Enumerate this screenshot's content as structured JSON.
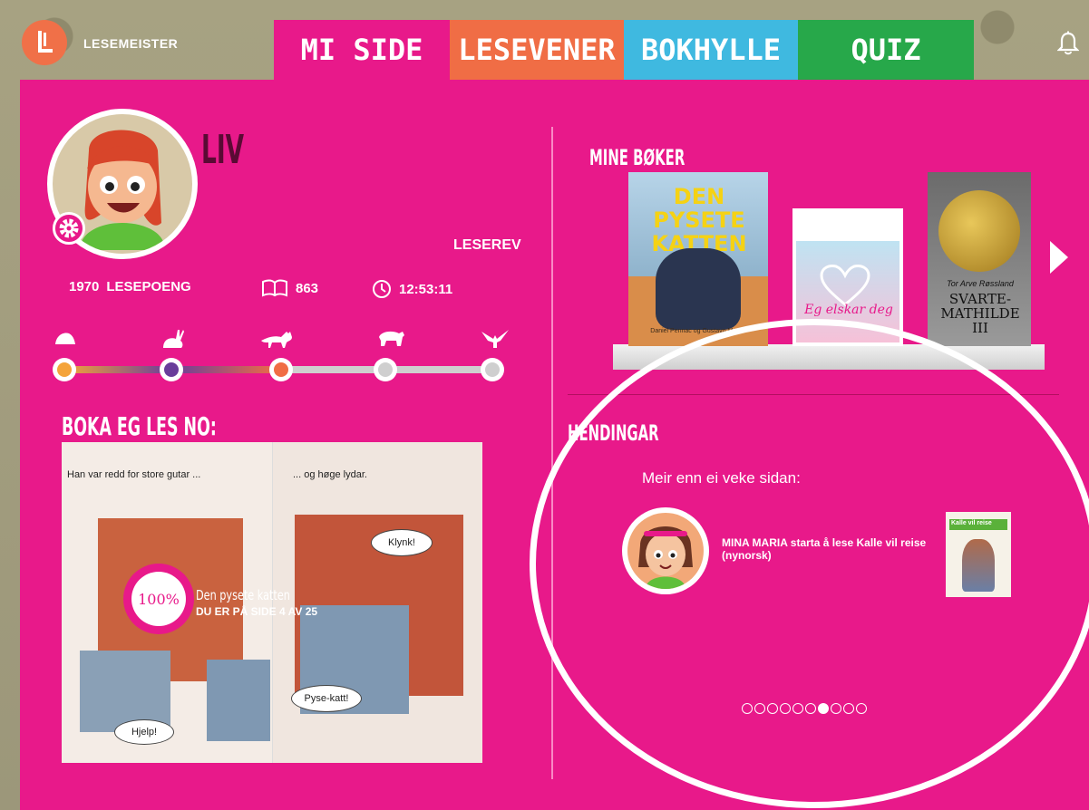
{
  "app": {
    "name": "LESEMEISTER"
  },
  "tabs": [
    {
      "label": "MI SIDE",
      "color": "#e8198a"
    },
    {
      "label": "LESEVENER",
      "color": "#f06d45"
    },
    {
      "label": "BOKHYLLE",
      "color": "#3fb9e0"
    },
    {
      "label": "QUIZ",
      "color": "#27a84a"
    }
  ],
  "profile": {
    "name": "LIV",
    "level": "LESEREV",
    "points": "1970",
    "points_label": "LESEPOENG",
    "pages": "863",
    "time": "12:53:11",
    "progress_fraction": 0.5
  },
  "reading": {
    "header": "BOKA EG LES NO:",
    "caption_left": "Han var redd for store gutar ...",
    "caption_right": "... og høge lydar.",
    "bubble1": "Klynk!",
    "bubble2": "Pyse-katt!",
    "bubble3": "Hjelp!",
    "percent": "100%",
    "title": "Den pysete katten",
    "page_status": "DU ER PÅ SIDE 4 AV 25"
  },
  "books": {
    "header": "MINE BØKER",
    "items": [
      {
        "title": "DEN PYSETE KATTEN",
        "authors": "Daniel Pennac og Gustavo Mazali"
      },
      {
        "title": "Eg elskar deg"
      },
      {
        "title": "SVARTE-MATHILDE III",
        "author": "Tor Arve Røssland"
      }
    ]
  },
  "events": {
    "header": "HENDINGAR",
    "when": "Meir enn ei veke sidan:",
    "text": "MINA MARIA starta å lese Kalle vil reise (nynorsk)",
    "book_title": "Kalle vil reise",
    "page_count": 10,
    "active_index": 6
  }
}
